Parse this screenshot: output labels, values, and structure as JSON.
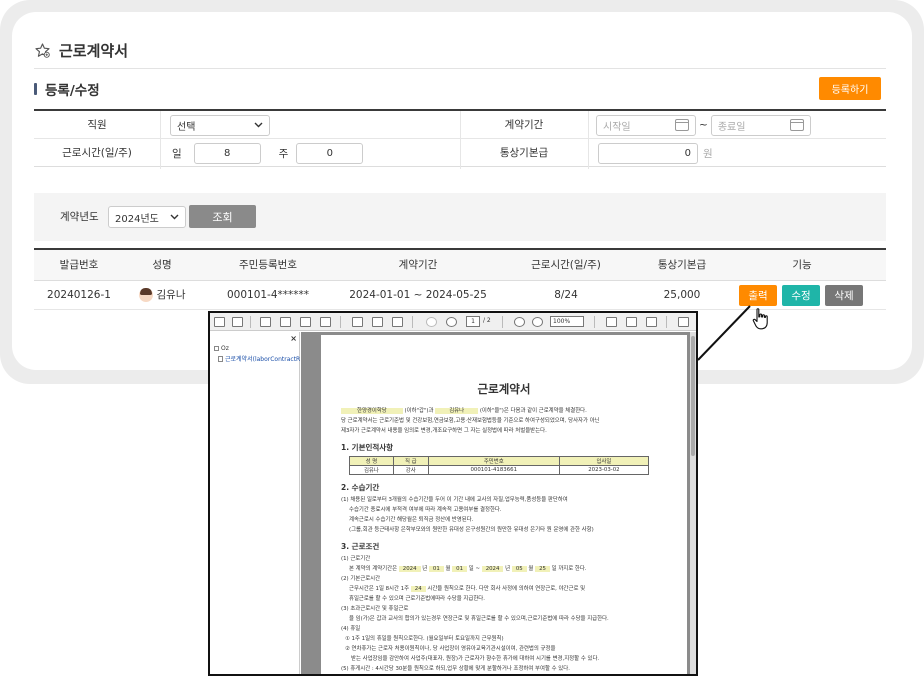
{
  "page": {
    "title": "근로계약서"
  },
  "section": {
    "title": "등록/수정",
    "register_button": "등록하기"
  },
  "form": {
    "employee_label": "직원",
    "employee_value": "선택",
    "period_label": "계약기간",
    "start_placeholder": "시작일",
    "tilde": "~",
    "end_placeholder": "종료일",
    "hours_label": "근로시간(일/주)",
    "day_label": "일",
    "day_value": "8",
    "week_label": "주",
    "week_value": "0",
    "wage_label": "통상기본급",
    "wage_value": "0",
    "wage_unit": "원"
  },
  "search": {
    "label": "계약년도",
    "year_value": "2024년도",
    "query_button": "조회"
  },
  "table": {
    "headers": [
      "발급번호",
      "성명",
      "주민등록번호",
      "계약기간",
      "근로시간(일/주)",
      "통상기본급",
      "기능"
    ],
    "rows": [
      {
        "issue_no": "20240126-1",
        "name": "김유나",
        "rrn": "000101-4******",
        "period": "2024-01-01 ~ 2024-05-25",
        "hours": "8/24",
        "wage": "25,000",
        "actions": {
          "print": "출력",
          "edit": "수정",
          "delete": "삭제"
        }
      }
    ]
  },
  "viewer": {
    "page_input": "1",
    "page_total": "/ 2",
    "zoom": "100%",
    "tree_root": "Oz",
    "tree_item": "근로계약서(laborContractR",
    "doc": {
      "title": "근로계약서",
      "intro_employer": "한양경이학당",
      "intro_mid": "(이하\"갑\")과",
      "intro_employee": "김유나",
      "intro_rest": "(이하\"을\")은 다음과 같이 근로계약을 체결한다.",
      "intro2": "당 근로계약서는 근로기준법 및 건강보험,연금보험,고용·산재보험법등을 기준으로 하여구성되었으며, 당사자가 아닌",
      "intro3": "제3자가 근로계약서 내용을 임의로 변경,개조요구하면 그 자는 실정법에 따라 처벌을받는다.",
      "s1": "1. 기본인적사항",
      "s1_headers": [
        "성 명",
        "직 급",
        "주민번호",
        "입사일"
      ],
      "s1_values": [
        "김유나",
        "강사",
        "000101-4183661",
        "2023-03-02"
      ],
      "s2": "2. 수습기간",
      "s2_l1": "(1) 채용된 일로부터 3개월의 수습기간을 두어 이 기간 내에 교사의 자질,업무능력,품성등을 판단하여",
      "s2_l2": "수습기간 종료시에 부적격 여부에 따라 계속적 고용여부를 결정한다.",
      "s2_l3": "계속근로시 수습기간 해당월은 퇴직금 정산에 반영된다.",
      "s2_l4": "(그룹,회관 등근태사항 은학부모와의 원만한 유대성 은구성원간의 원만한 유대성 은기타 원 운영에 관한 사항)",
      "s3": "3. 근로조건",
      "s3_l1": "(1) 근로기간",
      "s3_l2a": "본 계약의 계약기간은",
      "s3_y1": "2024",
      "s3_u1": "년",
      "s3_m1": "01",
      "s3_u2": "월",
      "s3_d1": "01",
      "s3_u3": "일",
      "s3_tilde": "~",
      "s3_y2": "2024",
      "s3_u4": "년",
      "s3_m2": "05",
      "s3_u5": "월",
      "s3_d2": "25",
      "s3_u6": "일 까지로 한다.",
      "s3_l3": "(2) 기본근로시간",
      "s3_l4a": "근무시간은 1일 8시간",
      "s3_l4b": "1주",
      "s3_l4c": "24",
      "s3_l4d": "시간을 원칙으로 한다. 다만 회사 사정에 의하여 연장근로, 야간근로 및",
      "s3_l5": "휴일근로를 할 수 있으며 근로기준법에따라 수당을 지급한다.",
      "s3_l6": "(3) 초과근로시간 및 휴일근로",
      "s3_l7": "을 임(가)은 갑과 교사의 합의가 있는경우 연장근로 및 휴일근로를 할 수 있으며,근로기준법에 따라 수당을 지급한다.",
      "s3_l8": "(4) 휴일",
      "s3_l9": "① 1주 1일의 휴일을 원칙으로한다. (월요일부터 토요일까지 근무원칙)",
      "s3_l10": "② 연차휴가는 근로자 처용이원칙이나, 당 사업장이 영유아교육기관시설이여, 관련법의 규정을",
      "s3_l11": "받는 사업장임을 감안하여 사업주(대표자, 원장)가 근로자가 향수한 휴가에 대하여 시기를 변경,지정할 수 있다.",
      "s3_l12": "(5) 휴게시간 : 4시간당 30분을 원칙으로 하되,업무 상황에 맞게 분할하거나 조정하여 부여할 수 있다."
    }
  }
}
